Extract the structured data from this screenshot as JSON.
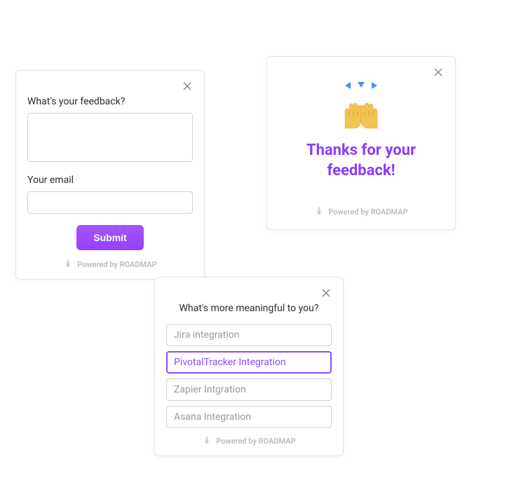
{
  "feedback_card": {
    "feedback_label": "What's your feedback?",
    "email_label": "Your email",
    "submit_label": "Submit"
  },
  "thanks_card": {
    "message": "Thanks for your feedback!"
  },
  "choice_card": {
    "question": "What's more meaningful to you?",
    "options": [
      {
        "label": "Jira integration",
        "selected": false
      },
      {
        "label": "PivotalTracker Integration",
        "selected": true
      },
      {
        "label": "Zapier Intgration",
        "selected": false
      },
      {
        "label": "Asana Integration",
        "selected": false
      }
    ]
  },
  "footer_text": "Powered by ROADMAP"
}
